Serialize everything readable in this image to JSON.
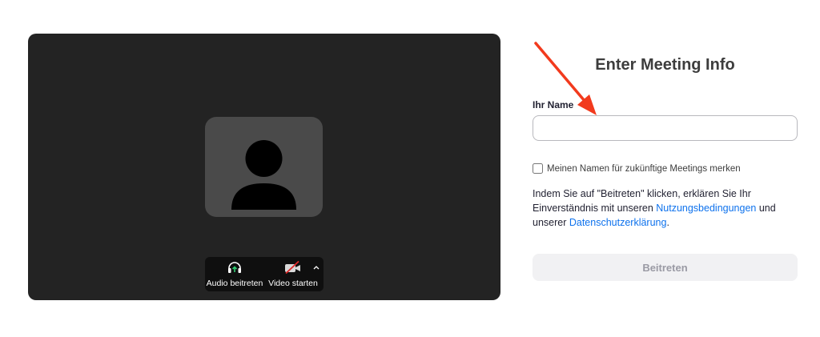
{
  "preview": {
    "audio_label": "Audio beitreten",
    "video_label": "Video starten"
  },
  "form": {
    "title": "Enter Meeting Info",
    "name_label": "Ihr Name",
    "name_value": "",
    "remember_label": "Meinen Namen für zukünftige Meetings merken",
    "remember_checked": false,
    "terms_before": "Indem Sie auf \"Beitreten\" klicken, erklären Sie Ihr Einverständnis mit unseren ",
    "terms_link_1": "Nutzungsbedingungen",
    "terms_middle": " und unserer ",
    "terms_link_2": "Datenschutzerklärung",
    "terms_after": ".",
    "join_label": "Beitreten"
  },
  "colors": {
    "link": "#0e72ed",
    "annotation_arrow": "#f23a1d",
    "preview_bg": "#232323"
  },
  "icons": {
    "avatar": "user-silhouette-icon",
    "audio": "headphones-up-arrow-icon",
    "video": "video-camera-off-icon",
    "caret": "chevron-up-icon"
  }
}
